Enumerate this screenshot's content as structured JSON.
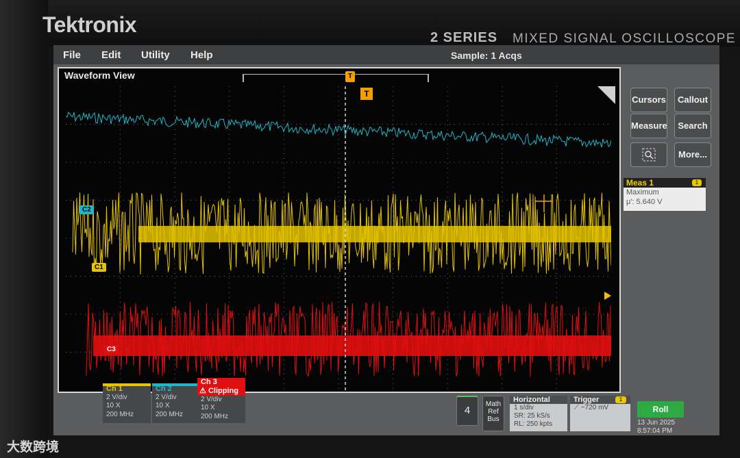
{
  "bezel": {
    "brand": "Tektronix",
    "series": "2 SERIES",
    "model": "MIXED SIGNAL OSCILLOSCOPE"
  },
  "menu": [
    "File",
    "Edit",
    "Utility",
    "Help"
  ],
  "acquisition_status": "Sample: 1 Acqs",
  "waveform_view": {
    "title": "Waveform View",
    "trigger_marker": "T"
  },
  "channel_flags": {
    "c2": "C2",
    "c1": "C1",
    "c3": "C3"
  },
  "side_buttons": {
    "cursors": "Cursors",
    "callout": "Callout",
    "measure": "Measure",
    "search": "Search",
    "more": "More..."
  },
  "measurement": {
    "header": "Meas 1",
    "badge": "1",
    "type": "Maximum",
    "value": "μ': 5.640 V"
  },
  "channels": [
    {
      "header": "Ch 1",
      "vdiv": "2 V/div",
      "probe": "10 X",
      "bw": "200 MHz",
      "color": "#e5c400"
    },
    {
      "header": "Ch 2",
      "vdiv": "2 V/div",
      "probe": "10 X",
      "bw": "200 MHz",
      "color": "#1fb8c8"
    },
    {
      "header": "Ch 3",
      "warning": "Clipping",
      "vdiv": "2 V/div",
      "probe": "10 X",
      "bw": "200 MHz",
      "color": "#e01010"
    }
  ],
  "add_channel": "4",
  "math_ref_bus": [
    "Math",
    "Ref",
    "Bus"
  ],
  "horizontal": {
    "header": "Horizontal",
    "scale": "1 s/div",
    "sample_rate": "SR: 25 kS/s",
    "record_length": "RL: 250 kpts"
  },
  "trigger": {
    "header": "Trigger",
    "badge": "1",
    "level": "~720 mV"
  },
  "run_state": "Roll",
  "datetime": {
    "date": "13 Jun 2025",
    "time": "8:57:04 PM"
  },
  "watermark": "大数跨境",
  "colors": {
    "ch1": "#e5c400",
    "ch2": "#1fb8c8",
    "ch3": "#e01010",
    "trigger": "#f0a000"
  }
}
